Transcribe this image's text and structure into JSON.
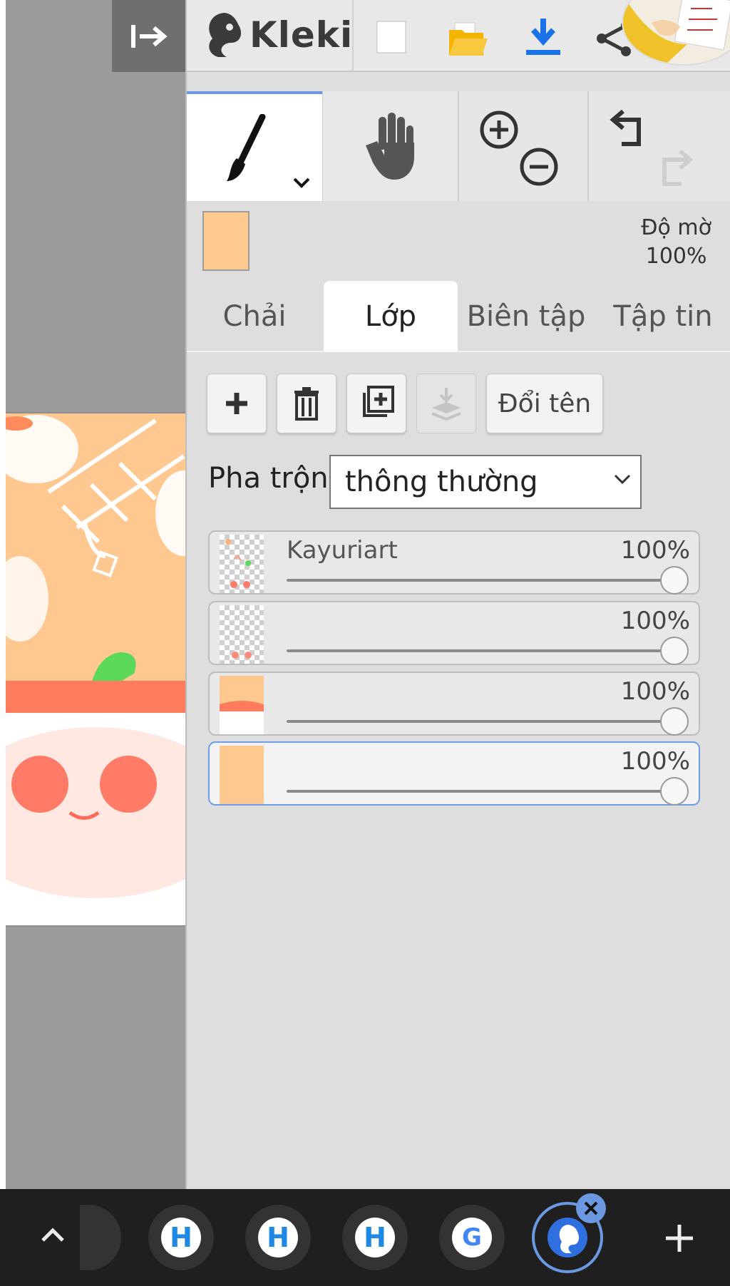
{
  "app": {
    "name": "Kleki"
  },
  "colors": {
    "primary": "#ffc990",
    "accent": "#6b98e0",
    "download": "#1a73e8",
    "folder": "#f4b400"
  },
  "toolbar": {
    "icons": [
      "collapse-panel-icon",
      "new-image-icon",
      "open-folder-icon",
      "download-icon",
      "share-icon"
    ],
    "avatar": "user-avatar"
  },
  "tools": {
    "brush": "brush-icon",
    "hand": "hand-icon",
    "zoom_in": "zoom-in-icon",
    "zoom_out": "zoom-out-icon",
    "undo": "undo-icon",
    "redo": "redo-icon"
  },
  "opacity": {
    "label": "Độ mờ",
    "value": "100%"
  },
  "tabs": [
    {
      "label": "Chải",
      "active": false
    },
    {
      "label": "Lớp",
      "active": true
    },
    {
      "label": "Biên tập",
      "active": false
    },
    {
      "label": "Tập tin",
      "active": false
    }
  ],
  "layer_buttons": {
    "rename_label": "Đổi tên"
  },
  "blend": {
    "label": "Pha trộn",
    "value": "thông thường"
  },
  "layers": [
    {
      "name": "Kayuriart",
      "opacity": "100%",
      "opacity_value": 1.0,
      "selected": false
    },
    {
      "name": "",
      "opacity": "100%",
      "opacity_value": 1.0,
      "selected": false
    },
    {
      "name": "",
      "opacity": "100%",
      "opacity_value": 1.0,
      "selected": false
    },
    {
      "name": "",
      "opacity": "100%",
      "opacity_value": 1.0,
      "selected": true
    }
  ],
  "bottom_bar": {
    "apps": [
      "H",
      "H",
      "H",
      "G"
    ],
    "icons": [
      "chevron-up-icon",
      "add-tab-icon",
      "close-icon"
    ]
  }
}
